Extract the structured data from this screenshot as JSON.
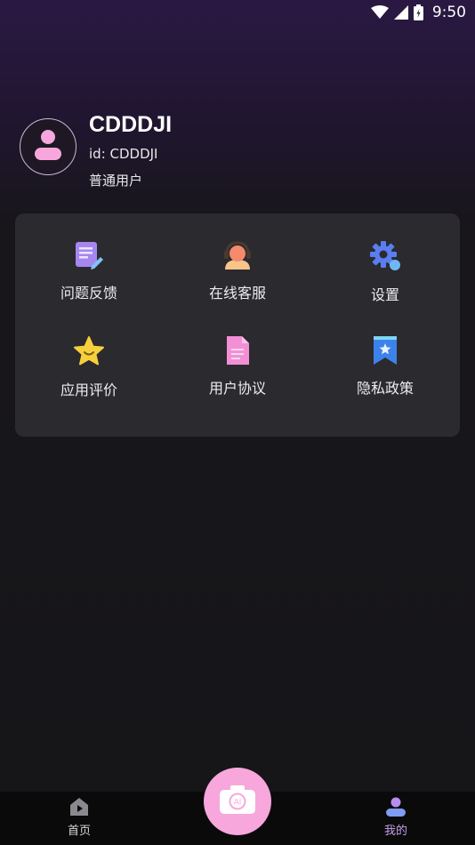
{
  "status_bar": {
    "time": "9:50",
    "icons": [
      "wifi-icon",
      "signal-icon",
      "battery-icon"
    ]
  },
  "profile": {
    "username": "CDDDJI",
    "user_id": "id: CDDDJI",
    "user_type": "普通用户",
    "avatar_icon": "person-icon"
  },
  "menu": {
    "items": [
      {
        "label": "问题反馈",
        "icon": "feedback-icon"
      },
      {
        "label": "在线客服",
        "icon": "customer-service-icon"
      },
      {
        "label": "设置",
        "icon": "gear-icon"
      },
      {
        "label": "应用评价",
        "icon": "star-icon"
      },
      {
        "label": "用户协议",
        "icon": "document-icon"
      },
      {
        "label": "隐私政策",
        "icon": "bookmark-icon"
      }
    ]
  },
  "bottom_nav": {
    "home_label": "首页",
    "mine_label": "我的",
    "camera_label": "AI",
    "active": "mine"
  },
  "colors": {
    "accent_pink": "#f7a7dc",
    "active_tab": "#c99ee8",
    "card_bg": "#2b2a2f"
  }
}
